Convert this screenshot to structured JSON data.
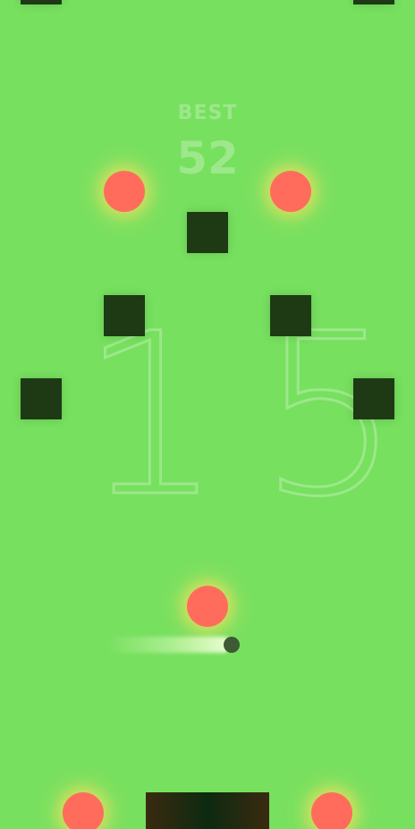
{
  "game": {
    "best_label": "BEST",
    "best_score": "52",
    "current_score": "15"
  },
  "colors": {
    "background": "#77e05f",
    "block": "#1d3a14",
    "orb": "#ff6c5c",
    "ball": "#3d5a35"
  },
  "icons": {
    "orb": "glowing-red-orb",
    "block": "dark-square-obstacle",
    "ball": "player-ball"
  }
}
